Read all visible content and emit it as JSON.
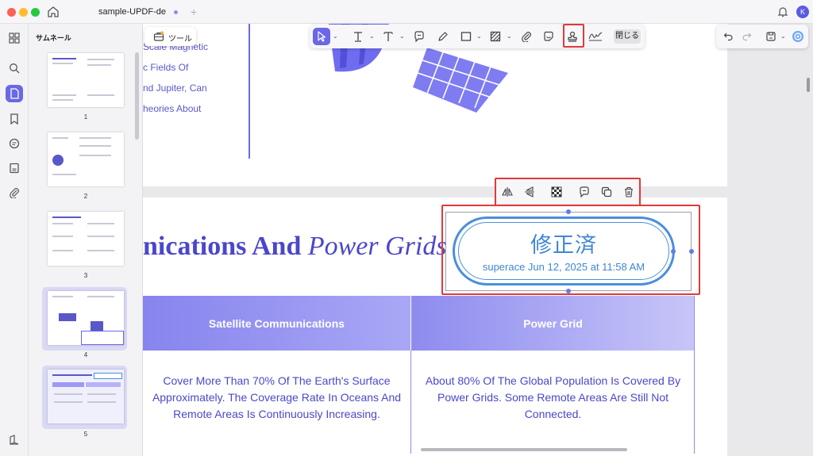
{
  "window": {
    "tab_title": "sample-UPDF-de",
    "avatar_letter": "K"
  },
  "sidebar": {
    "title": "サムネール",
    "pages": [
      "1",
      "2",
      "3",
      "4",
      "5"
    ]
  },
  "tools_button": {
    "label": "ツール"
  },
  "toolbar": {
    "close_label": "閉じる"
  },
  "page1": {
    "lines": [
      "Scale Magnetic",
      "c Fields Of",
      "nd Jupiter, Can",
      "heories About"
    ]
  },
  "page2": {
    "heading_bold": "nications And",
    "heading_italic": "Power Grids",
    "table": {
      "headers": [
        "Satellite Communications",
        "Power Grid"
      ],
      "cells": [
        "Cover More Than 70% Of The Earth's Surface Approximately. The Coverage Rate In Oceans And Remote Areas Is Continuously Increasing.",
        "About 80% Of The Global Population Is Covered By Power Grids. Some Remote Areas Are Still Not Connected."
      ]
    }
  },
  "stamp": {
    "title": "修正済",
    "subtitle": "superace Jun 12, 2025 at 11:58 AM"
  },
  "colors": {
    "accent": "#6a67e8",
    "highlight": "#e03a3a",
    "stamp": "#3f86d6"
  },
  "icons": {
    "toolbar": [
      "select-icon",
      "text-icon",
      "text-box-icon",
      "comment-icon",
      "pencil-icon",
      "rectangle-icon",
      "pattern-icon",
      "attachment-icon",
      "sticker-icon",
      "stamp-icon",
      "signature-icon"
    ],
    "stamp_toolbar": [
      "flip-horizontal-icon",
      "flip-vertical-icon",
      "opacity-icon",
      "comment-icon",
      "duplicate-icon",
      "trash-icon"
    ]
  }
}
